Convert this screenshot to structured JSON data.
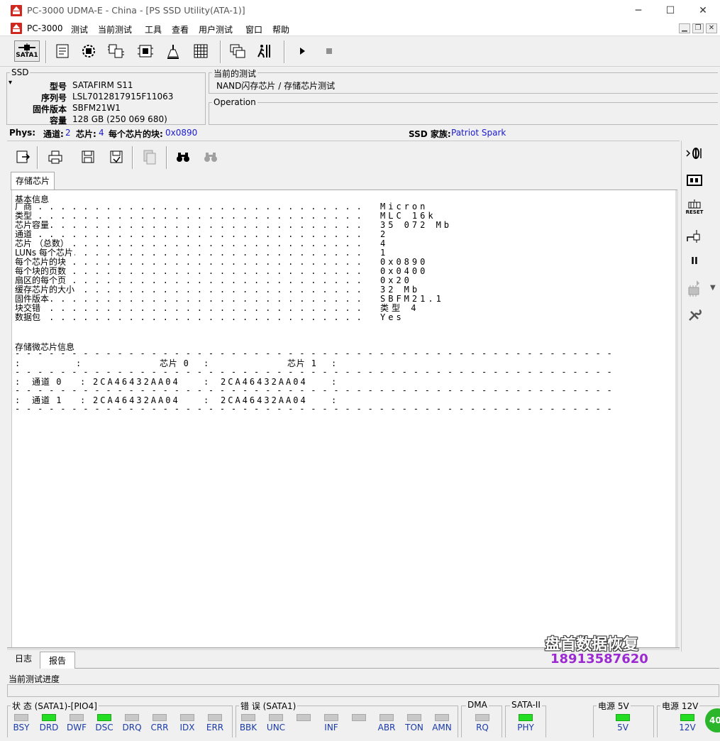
{
  "window": {
    "title": "PC-3000 UDMA-E - China - [PS SSD Utility(ATA-1)]",
    "minimize_glyph": "─",
    "maximize_glyph": "☐",
    "close_glyph": "✕"
  },
  "menu": {
    "items": [
      "PC-3000",
      "测试",
      "当前测试",
      "工具",
      "查看",
      "用户测试",
      "窗口",
      "帮助"
    ],
    "mdi": {
      "minimize": "▁",
      "restore": "❐",
      "close": "✕"
    }
  },
  "toolbar": {
    "sata_label": "SATA1",
    "icons": [
      "sata-port-icon",
      "terminal-icon",
      "gear-chip-icon",
      "chip-copy-icon",
      "chip-reset-icon",
      "tools-icon",
      "grid-icon",
      "windows-icon",
      "runner-icon",
      "play-icon",
      "stop-icon"
    ]
  },
  "ssd_panel": {
    "title": "SSD",
    "fields": [
      {
        "label": "型号",
        "value": "SATAFIRM   S11"
      },
      {
        "label": "序列号",
        "value": "LSL7012817915F11063"
      },
      {
        "label": "固件版本",
        "value": "SBFM21W1"
      },
      {
        "label": "容量",
        "value": "128 GB (250 069 680)"
      }
    ]
  },
  "current_test": {
    "title": "当前的测试",
    "value": "NAND闪存芯片 / 存储芯片测试",
    "operation_title": "Operation"
  },
  "phys_bar": {
    "phys_label": "Phys:",
    "channels_label": "通道:",
    "channels_value": "2",
    "chips_label": "芯片:",
    "chips_value": "4",
    "blocks_label": "每个芯片的块:",
    "blocks_value": "0x0890",
    "family_label": "SSD 家族:",
    "family_value": "Patriot Spark"
  },
  "inner_toolbar": {
    "icons": [
      "export-icon",
      "print-icon",
      "save-icon",
      "save-all-icon",
      "copy-icon",
      "find-icon",
      "find-next-icon"
    ]
  },
  "tabs": {
    "active": "存储芯片"
  },
  "report": {
    "basic_title": "基本信息",
    "rows": [
      {
        "label": "厂商",
        "value": "Micron"
      },
      {
        "label": "类型",
        "value": "MLC 16k"
      },
      {
        "label": "芯片容量",
        "value": "35 072 Mb"
      },
      {
        "label": "通道",
        "value": "2"
      },
      {
        "label": "芯片 （总数）",
        "value": "4"
      },
      {
        "label": "LUNs 每个芯片",
        "value": "1"
      },
      {
        "label": "每个芯片的块",
        "value": "0x0890"
      },
      {
        "label": "每个块的页数",
        "value": "0x0400"
      },
      {
        "label": "扇区的每个页",
        "value": "0x20"
      },
      {
        "label": "缓存芯片的大小",
        "value": "32 Mb"
      },
      {
        "label": "固件版本",
        "value": "SBFM21.1"
      },
      {
        "label": "块交错",
        "value": "类型 4"
      },
      {
        "label": "数据包",
        "value": "Yes"
      }
    ],
    "chip_title": "存储微芯片信息",
    "table_header": [
      ":",
      ":",
      "芯片 0",
      ":",
      "芯片 1",
      ":"
    ],
    "table_rows": [
      {
        "ch": "通道 0",
        "c0": "2CA46432AA04",
        "c1": "2CA46432AA04"
      },
      {
        "ch": "通道 1",
        "c0": "2CA46432AA04",
        "c1": "2CA46432AA04"
      }
    ]
  },
  "watermark": {
    "line1": "盘首数据恢复",
    "line2": "18913587620"
  },
  "right_toolbar": {
    "icons": [
      "reset-power-icon",
      "chip-info-icon",
      "reset-icon",
      "plug-icon",
      "pause-icon",
      "chip-disabled-icon",
      "wrench-icon"
    ],
    "reset_label": "RESET",
    "pause_glyph": "II"
  },
  "bottom_tabs": {
    "items": [
      "日志",
      "报告"
    ],
    "active": 1
  },
  "progress": {
    "label": "当前测试进度",
    "fraction": 0
  },
  "status": {
    "state_group": "状 态 (SATA1)-[PIO4]",
    "state_leds": [
      {
        "label": "BSY",
        "on": false
      },
      {
        "label": "DRD",
        "on": true
      },
      {
        "label": "DWF",
        "on": false
      },
      {
        "label": "DSC",
        "on": true
      },
      {
        "label": "DRQ",
        "on": false
      },
      {
        "label": "CRR",
        "on": false
      },
      {
        "label": "IDX",
        "on": false
      },
      {
        "label": "ERR",
        "on": false
      }
    ],
    "error_group": "错 误 (SATA1)",
    "error_leds": [
      {
        "label": "BBK",
        "on": false
      },
      {
        "label": "UNC",
        "on": false
      },
      {
        "label": "",
        "on": false
      },
      {
        "label": "INF",
        "on": false
      },
      {
        "label": "",
        "on": false
      },
      {
        "label": "ABR",
        "on": false
      },
      {
        "label": "TON",
        "on": false
      },
      {
        "label": "AMN",
        "on": false
      }
    ],
    "dma_group": "DMA",
    "dma_led": {
      "label": "RQ",
      "on": false
    },
    "sata_group": "SATA-II",
    "sata_led": {
      "label": "PHY",
      "on": true
    },
    "power5_group": "电源 5V",
    "power5_led": {
      "label": "5V",
      "on": true
    },
    "power12_group": "电源 12V",
    "power12_led": {
      "label": "12V",
      "on": true
    },
    "badge": "40"
  },
  "colors": {
    "accent_blue": "#1a1ad0",
    "led_on": "#22dd22",
    "led_off": "#c8c8c8",
    "logo_red": "#d0281e"
  }
}
